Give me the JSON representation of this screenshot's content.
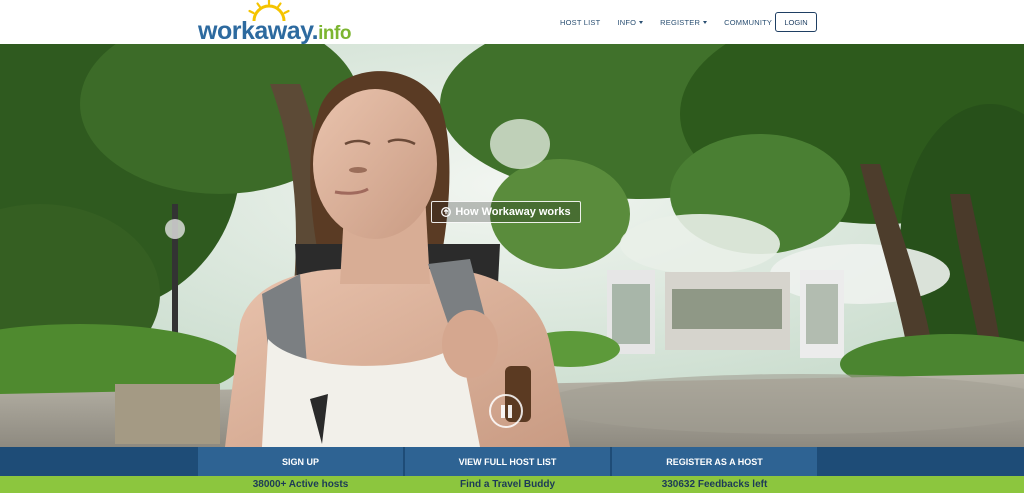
{
  "header": {
    "logo": {
      "word": "workaway",
      "suffix": "info",
      "dot": "."
    },
    "nav": [
      {
        "label": "HOST LIST",
        "dropdown": false
      },
      {
        "label": "INFO",
        "dropdown": true
      },
      {
        "label": "REGISTER",
        "dropdown": true
      },
      {
        "label": "COMMUNITY",
        "dropdown": true
      }
    ],
    "login_label": "LOGIN"
  },
  "hero": {
    "how_label": "How Workaway works",
    "how_icon": "arrow-circle-icon",
    "pause_icon": "pause-icon"
  },
  "cta": {
    "sign_up": "SIGN UP",
    "host_list": "VIEW FULL HOST LIST",
    "register_host": "REGISTER AS A HOST"
  },
  "stats": {
    "hosts": "38000+ Active hosts",
    "buddy": "Find a Travel Buddy",
    "feedbacks": "330632 Feedbacks left"
  },
  "colors": {
    "brand_blue": "#2d6a9f",
    "brand_green": "#7cb530",
    "cta_bar": "#1e4c77",
    "cta_button": "#2e6393",
    "stats_bar": "#8cc63e"
  }
}
